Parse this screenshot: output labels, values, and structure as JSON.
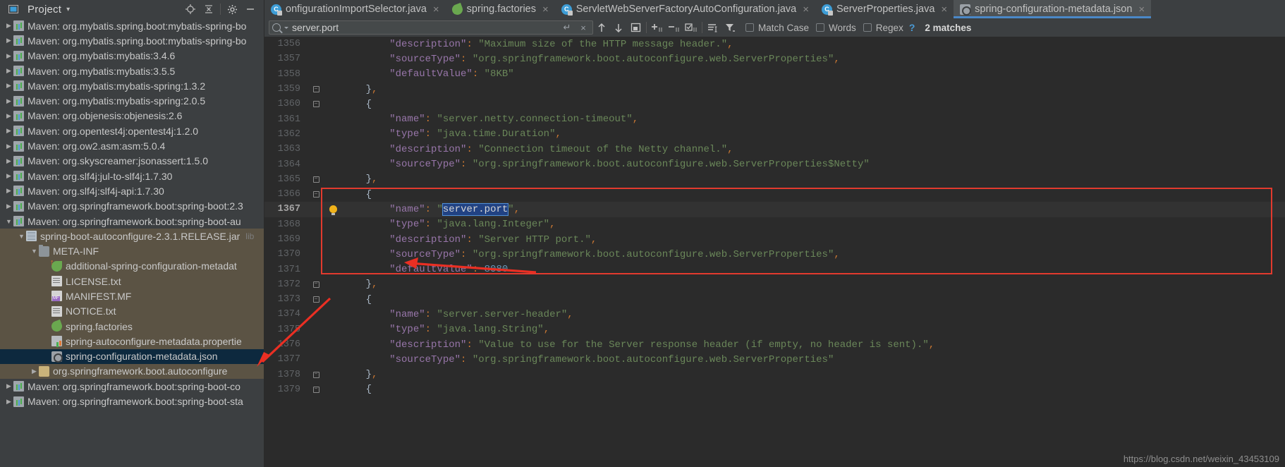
{
  "project_panel": {
    "title": "Project",
    "caret": "▾",
    "icons": [
      "project-locate-icon",
      "collapse-all-icon",
      "settings-gear-icon",
      "hide-icon"
    ]
  },
  "tabs": [
    {
      "label": "onfigurationImportSelector.java",
      "icon": "java-class-icon",
      "active": false,
      "close": "×"
    },
    {
      "label": "spring.factories",
      "icon": "spring-factories-icon",
      "active": false,
      "close": "×"
    },
    {
      "label": "ServletWebServerFactoryAutoConfiguration.java",
      "icon": "java-class-icon",
      "active": false,
      "close": "×"
    },
    {
      "label": "ServerProperties.java",
      "icon": "java-class-icon",
      "active": false,
      "close": "×"
    },
    {
      "label": "spring-configuration-metadata.json",
      "icon": "json-metadata-icon",
      "active": true,
      "close": "×"
    }
  ],
  "search": {
    "value": "server.port",
    "placeholder": "Search",
    "enter_icon": "↵",
    "clear_icon": "×",
    "buttons": [
      {
        "name": "find-previous-button",
        "glyph": "↑"
      },
      {
        "name": "find-next-button",
        "glyph": "↓"
      },
      {
        "name": "open-in-find-window-button",
        "glyph": "◳"
      },
      {
        "name": "add-occurrence-button",
        "glyph": "+"
      },
      {
        "name": "remove-occurrence-button",
        "glyph": "−"
      },
      {
        "name": "select-all-occurrences-button",
        "glyph": "☑"
      },
      {
        "name": "in-selection-button",
        "glyph": "≡"
      },
      {
        "name": "filter-button",
        "glyph": "▼"
      }
    ],
    "checkboxes": [
      {
        "label": "Match Case",
        "checked": false
      },
      {
        "label": "Words",
        "checked": false
      },
      {
        "label": "Regex",
        "checked": false
      }
    ],
    "help": "?",
    "result_count": "2 matches"
  },
  "sidebar": {
    "items": [
      {
        "label": "Maven: org.mybatis.spring.boot:mybatis-spring-bo",
        "indent": 1,
        "arrow": "▶",
        "icon": "maven-icon",
        "state": "normal"
      },
      {
        "label": "Maven: org.mybatis.spring.boot:mybatis-spring-bo",
        "indent": 1,
        "arrow": "▶",
        "icon": "maven-icon",
        "state": "normal"
      },
      {
        "label": "Maven: org.mybatis:mybatis:3.4.6",
        "indent": 1,
        "arrow": "▶",
        "icon": "maven-icon",
        "state": "normal"
      },
      {
        "label": "Maven: org.mybatis:mybatis:3.5.5",
        "indent": 1,
        "arrow": "▶",
        "icon": "maven-icon",
        "state": "normal"
      },
      {
        "label": "Maven: org.mybatis:mybatis-spring:1.3.2",
        "indent": 1,
        "arrow": "▶",
        "icon": "maven-icon",
        "state": "normal"
      },
      {
        "label": "Maven: org.mybatis:mybatis-spring:2.0.5",
        "indent": 1,
        "arrow": "▶",
        "icon": "maven-icon",
        "state": "normal"
      },
      {
        "label": "Maven: org.objenesis:objenesis:2.6",
        "indent": 1,
        "arrow": "▶",
        "icon": "maven-icon",
        "state": "normal"
      },
      {
        "label": "Maven: org.opentest4j:opentest4j:1.2.0",
        "indent": 1,
        "arrow": "▶",
        "icon": "maven-icon",
        "state": "normal"
      },
      {
        "label": "Maven: org.ow2.asm:asm:5.0.4",
        "indent": 1,
        "arrow": "▶",
        "icon": "maven-icon",
        "state": "normal"
      },
      {
        "label": "Maven: org.skyscreamer:jsonassert:1.5.0",
        "indent": 1,
        "arrow": "▶",
        "icon": "maven-icon",
        "state": "normal"
      },
      {
        "label": "Maven: org.slf4j:jul-to-slf4j:1.7.30",
        "indent": 1,
        "arrow": "▶",
        "icon": "maven-icon",
        "state": "normal"
      },
      {
        "label": "Maven: org.slf4j:slf4j-api:1.7.30",
        "indent": 1,
        "arrow": "▶",
        "icon": "maven-icon",
        "state": "normal"
      },
      {
        "label": "Maven: org.springframework.boot:spring-boot:2.3",
        "indent": 1,
        "arrow": "▶",
        "icon": "maven-icon",
        "state": "normal"
      },
      {
        "label": "Maven: org.springframework.boot:spring-boot-au",
        "indent": 1,
        "arrow": "▼",
        "icon": "maven-icon",
        "state": "normal"
      },
      {
        "label": "spring-boot-autoconfigure-2.3.1.RELEASE.jar",
        "suffix": "lib",
        "indent": 2,
        "arrow": "▼",
        "icon": "jar-icon",
        "state": "highlight"
      },
      {
        "label": "META-INF",
        "indent": 3,
        "arrow": "▼",
        "icon": "folder-icon",
        "state": "highlight"
      },
      {
        "label": "additional-spring-configuration-metadat",
        "indent": 4,
        "arrow": "",
        "icon": "additional-json-icon",
        "state": "highlight"
      },
      {
        "label": "LICENSE.txt",
        "indent": 4,
        "arrow": "",
        "icon": "text-file-icon",
        "state": "highlight"
      },
      {
        "label": "MANIFEST.MF",
        "indent": 4,
        "arrow": "",
        "icon": "manifest-icon",
        "state": "highlight"
      },
      {
        "label": "NOTICE.txt",
        "indent": 4,
        "arrow": "",
        "icon": "text-file-icon",
        "state": "highlight"
      },
      {
        "label": "spring.factories",
        "indent": 4,
        "arrow": "",
        "icon": "spring-factories-icon",
        "state": "highlight"
      },
      {
        "label": "spring-autoconfigure-metadata.propertie",
        "indent": 4,
        "arrow": "",
        "icon": "properties-file-icon",
        "state": "highlight"
      },
      {
        "label": "spring-configuration-metadata.json",
        "indent": 4,
        "arrow": "",
        "icon": "json-metadata-icon",
        "state": "selected"
      },
      {
        "label": "org.springframework.boot.autoconfigure",
        "indent": 3,
        "arrow": "▶",
        "icon": "package-icon",
        "state": "highlight"
      },
      {
        "label": "Maven: org.springframework.boot:spring-boot-co",
        "indent": 1,
        "arrow": "▶",
        "icon": "maven-icon",
        "state": "normal"
      },
      {
        "label": "Maven: org.springframework.boot:spring-boot-sta",
        "indent": 1,
        "arrow": "▶",
        "icon": "maven-icon",
        "state": "normal"
      }
    ]
  },
  "editor": {
    "first_line": 1356,
    "current_line": 1367,
    "lines": [
      {
        "num": 1356,
        "fold": "",
        "indent": 4,
        "tokens": [
          {
            "t": "k",
            "v": "\"description\""
          },
          {
            "t": "p",
            "v": ":"
          },
          {
            "t": "x",
            "v": " "
          },
          {
            "t": "s",
            "v": "\"Maximum size of the HTTP message header.\""
          },
          {
            "t": "p",
            "v": ","
          }
        ]
      },
      {
        "num": 1357,
        "fold": "",
        "indent": 4,
        "tokens": [
          {
            "t": "k",
            "v": "\"sourceType\""
          },
          {
            "t": "p",
            "v": ":"
          },
          {
            "t": "x",
            "v": " "
          },
          {
            "t": "s",
            "v": "\"org.springframework.boot.autoconfigure.web.ServerProperties\""
          },
          {
            "t": "p",
            "v": ","
          }
        ]
      },
      {
        "num": 1358,
        "fold": "",
        "indent": 4,
        "tokens": [
          {
            "t": "k",
            "v": "\"defaultValue\""
          },
          {
            "t": "p",
            "v": ":"
          },
          {
            "t": "x",
            "v": " "
          },
          {
            "t": "s",
            "v": "\"8KB\""
          }
        ]
      },
      {
        "num": 1359,
        "fold": "end",
        "indent": 2,
        "tokens": [
          {
            "t": "b",
            "v": "}"
          },
          {
            "t": "p",
            "v": ","
          }
        ]
      },
      {
        "num": 1360,
        "fold": "start",
        "indent": 2,
        "tokens": [
          {
            "t": "b",
            "v": "{"
          }
        ]
      },
      {
        "num": 1361,
        "fold": "",
        "indent": 4,
        "tokens": [
          {
            "t": "k",
            "v": "\"name\""
          },
          {
            "t": "p",
            "v": ":"
          },
          {
            "t": "x",
            "v": " "
          },
          {
            "t": "s",
            "v": "\"server.netty.connection-timeout\""
          },
          {
            "t": "p",
            "v": ","
          }
        ]
      },
      {
        "num": 1362,
        "fold": "",
        "indent": 4,
        "tokens": [
          {
            "t": "k",
            "v": "\"type\""
          },
          {
            "t": "p",
            "v": ":"
          },
          {
            "t": "x",
            "v": " "
          },
          {
            "t": "s",
            "v": "\"java.time.Duration\""
          },
          {
            "t": "p",
            "v": ","
          }
        ]
      },
      {
        "num": 1363,
        "fold": "",
        "indent": 4,
        "tokens": [
          {
            "t": "k",
            "v": "\"description\""
          },
          {
            "t": "p",
            "v": ":"
          },
          {
            "t": "x",
            "v": " "
          },
          {
            "t": "s",
            "v": "\"Connection timeout of the Netty channel.\""
          },
          {
            "t": "p",
            "v": ","
          }
        ]
      },
      {
        "num": 1364,
        "fold": "",
        "indent": 4,
        "tokens": [
          {
            "t": "k",
            "v": "\"sourceType\""
          },
          {
            "t": "p",
            "v": ":"
          },
          {
            "t": "x",
            "v": " "
          },
          {
            "t": "s",
            "v": "\"org.springframework.boot.autoconfigure.web.ServerProperties$Netty\""
          }
        ]
      },
      {
        "num": 1365,
        "fold": "end",
        "indent": 2,
        "tokens": [
          {
            "t": "b",
            "v": "}"
          },
          {
            "t": "p",
            "v": ","
          }
        ]
      },
      {
        "num": 1366,
        "fold": "start",
        "indent": 2,
        "tokens": [
          {
            "t": "b",
            "v": "{"
          }
        ]
      },
      {
        "num": 1367,
        "fold": "bulb",
        "indent": 4,
        "current": true,
        "tokens": [
          {
            "t": "k",
            "v": "\"name\""
          },
          {
            "t": "p",
            "v": ":"
          },
          {
            "t": "x",
            "v": " "
          },
          {
            "t": "s",
            "v": "\""
          },
          {
            "t": "sel",
            "v": "server.port"
          },
          {
            "t": "s",
            "v": "\""
          },
          {
            "t": "p",
            "v": ","
          }
        ]
      },
      {
        "num": 1368,
        "fold": "",
        "indent": 4,
        "tokens": [
          {
            "t": "k",
            "v": "\"type\""
          },
          {
            "t": "p",
            "v": ":"
          },
          {
            "t": "x",
            "v": " "
          },
          {
            "t": "s",
            "v": "\"java.lang.Integer\""
          },
          {
            "t": "p",
            "v": ","
          }
        ]
      },
      {
        "num": 1369,
        "fold": "",
        "indent": 4,
        "tokens": [
          {
            "t": "k",
            "v": "\"description\""
          },
          {
            "t": "p",
            "v": ":"
          },
          {
            "t": "x",
            "v": " "
          },
          {
            "t": "s",
            "v": "\"Server HTTP port.\""
          },
          {
            "t": "p",
            "v": ","
          }
        ]
      },
      {
        "num": 1370,
        "fold": "",
        "indent": 4,
        "tokens": [
          {
            "t": "k",
            "v": "\"sourceType\""
          },
          {
            "t": "p",
            "v": ":"
          },
          {
            "t": "x",
            "v": " "
          },
          {
            "t": "s",
            "v": "\"org.springframework.boot.autoconfigure.web.ServerProperties\""
          },
          {
            "t": "p",
            "v": ","
          }
        ]
      },
      {
        "num": 1371,
        "fold": "",
        "indent": 4,
        "tokens": [
          {
            "t": "k",
            "v": "\"defaultValue\""
          },
          {
            "t": "p",
            "v": ":"
          },
          {
            "t": "x",
            "v": " "
          },
          {
            "t": "n",
            "v": "8080"
          }
        ]
      },
      {
        "num": 1372,
        "fold": "end",
        "indent": 2,
        "tokens": [
          {
            "t": "b",
            "v": "}"
          },
          {
            "t": "p",
            "v": ","
          }
        ]
      },
      {
        "num": 1373,
        "fold": "start",
        "indent": 2,
        "tokens": [
          {
            "t": "b",
            "v": "{"
          }
        ]
      },
      {
        "num": 1374,
        "fold": "",
        "indent": 4,
        "tokens": [
          {
            "t": "k",
            "v": "\"name\""
          },
          {
            "t": "p",
            "v": ":"
          },
          {
            "t": "x",
            "v": " "
          },
          {
            "t": "s",
            "v": "\"server.server-header\""
          },
          {
            "t": "p",
            "v": ","
          }
        ]
      },
      {
        "num": 1375,
        "fold": "",
        "indent": 4,
        "tokens": [
          {
            "t": "k",
            "v": "\"type\""
          },
          {
            "t": "p",
            "v": ":"
          },
          {
            "t": "x",
            "v": " "
          },
          {
            "t": "s",
            "v": "\"java.lang.String\""
          },
          {
            "t": "p",
            "v": ","
          }
        ]
      },
      {
        "num": 1376,
        "fold": "",
        "indent": 4,
        "tokens": [
          {
            "t": "k",
            "v": "\"description\""
          },
          {
            "t": "p",
            "v": ":"
          },
          {
            "t": "x",
            "v": " "
          },
          {
            "t": "s",
            "v": "\"Value to use for the Server response header (if empty, no header is sent).\""
          },
          {
            "t": "p",
            "v": ","
          }
        ]
      },
      {
        "num": 1377,
        "fold": "",
        "indent": 4,
        "tokens": [
          {
            "t": "k",
            "v": "\"sourceType\""
          },
          {
            "t": "p",
            "v": ":"
          },
          {
            "t": "x",
            "v": " "
          },
          {
            "t": "s",
            "v": "\"org.springframework.boot.autoconfigure.web.ServerProperties\""
          }
        ]
      },
      {
        "num": 1378,
        "fold": "end",
        "indent": 2,
        "tokens": [
          {
            "t": "b",
            "v": "}"
          },
          {
            "t": "p",
            "v": ","
          }
        ]
      },
      {
        "num": 1379,
        "fold": "start",
        "indent": 2,
        "tokens": [
          {
            "t": "b",
            "v": "{"
          }
        ]
      }
    ]
  },
  "annotations": {
    "highlight_color": "#e23a2e",
    "arrow_to_default_value": "red-arrow-pointing-to-8080",
    "arrow_to_tree_item": "red-arrow-pointing-to-selected-file"
  },
  "watermark": "https://blog.csdn.net/weixin_43453109"
}
